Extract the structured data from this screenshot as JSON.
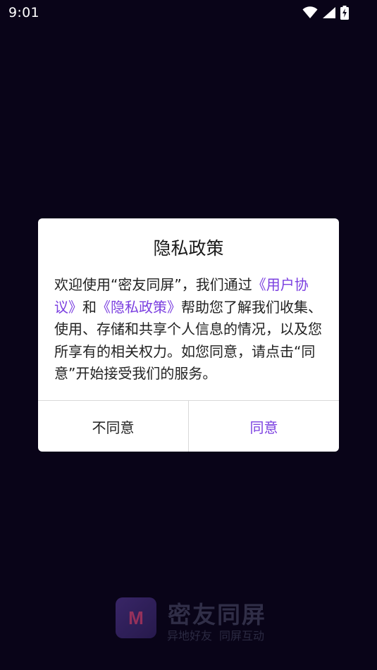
{
  "status_bar": {
    "time": "9:01",
    "icons": [
      "wifi-icon",
      "signal-icon",
      "battery-charging-icon"
    ]
  },
  "splash": {
    "app_name": "密友同屏",
    "slogan_left": "异地好友",
    "slogan_right": "同屏互动",
    "logo_letter": "M"
  },
  "dialog": {
    "title": "隐私政策",
    "body_text_1": "欢迎使用“密友同屏”，我们通过",
    "link_user_agreement": "《用户协议》",
    "body_text_2": "和",
    "link_privacy_policy": "《隐私政策》",
    "body_text_3": "帮助您了解我们收集、使用、存储和共享个人信息的情况，以及您所享有的相关权力。如您同意，请点击“同意”开始接受我们的服务。",
    "decline_label": "不同意",
    "agree_label": "同意"
  },
  "colors": {
    "background": "#090418",
    "accent": "#7b3fe0",
    "dialog_bg": "#ffffff"
  }
}
